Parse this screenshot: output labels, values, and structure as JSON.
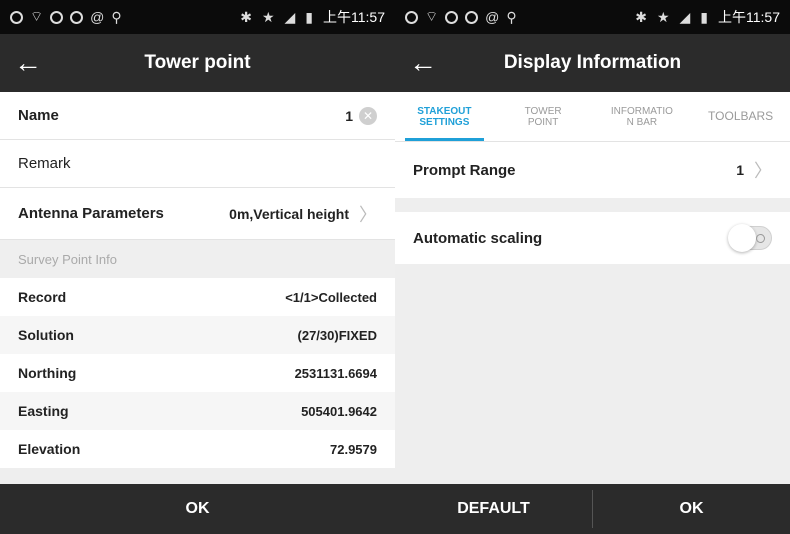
{
  "status": {
    "time": "上午11:57"
  },
  "left": {
    "title": "Tower point",
    "fields": [
      {
        "label": "Name",
        "value": "1"
      },
      {
        "label": "Remark",
        "value": ""
      },
      {
        "label": "Antenna Parameters",
        "value": "0m,Vertical height"
      }
    ],
    "section_title": "Survey Point Info",
    "info": [
      {
        "label": "Record",
        "value": "<1/1>Collected"
      },
      {
        "label": "Solution",
        "value": "(27/30)FIXED"
      },
      {
        "label": "Northing",
        "value": "2531131.6694"
      },
      {
        "label": "Easting",
        "value": "505401.9642"
      },
      {
        "label": "Elevation",
        "value": "72.9579"
      }
    ],
    "ok_label": "OK"
  },
  "right": {
    "title": "Display Information",
    "tabs": [
      {
        "line1": "STAKEOUT",
        "line2": "SETTINGS"
      },
      {
        "line1": "TOWER",
        "line2": "POINT"
      },
      {
        "line1": "INFORMATIO",
        "line2": "N BAR"
      },
      {
        "line1": "TOOLBARS",
        "line2": ""
      }
    ],
    "prompt_label": "Prompt Range",
    "prompt_value": "1",
    "scaling_label": "Automatic scaling",
    "default_label": "DEFAULT",
    "ok_label": "OK"
  }
}
